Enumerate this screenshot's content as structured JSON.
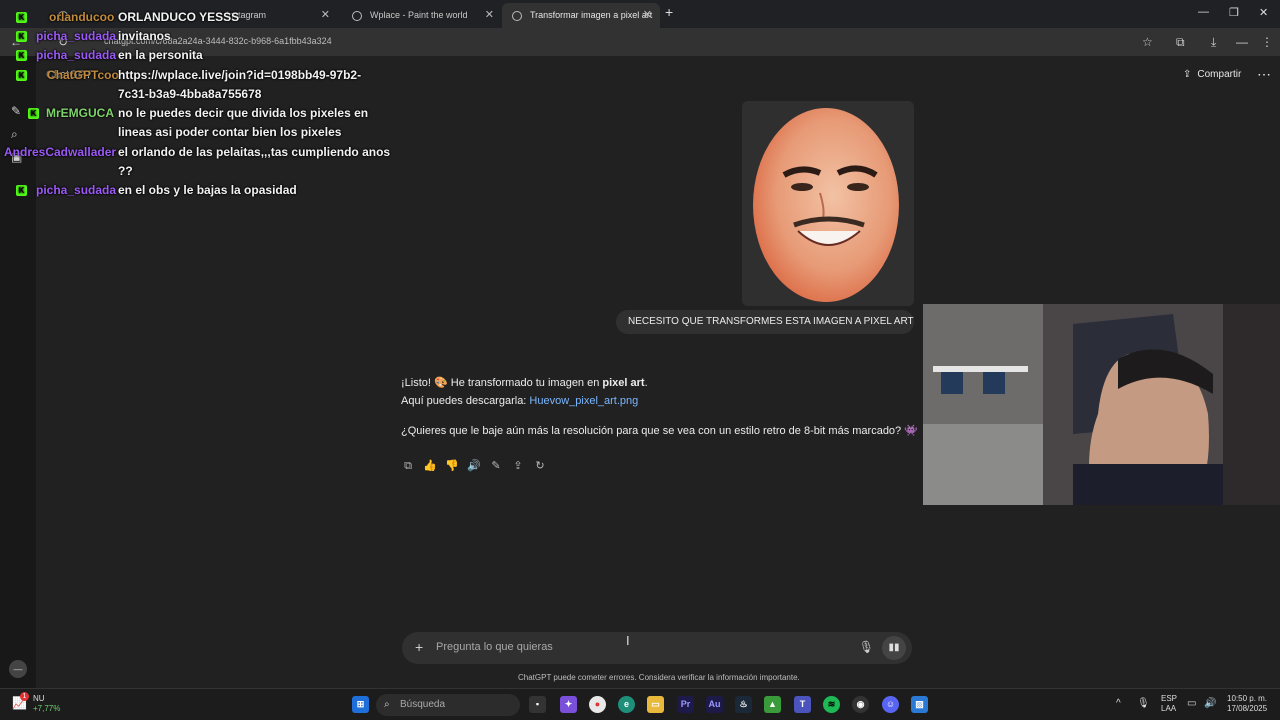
{
  "browser": {
    "tabs": [
      {
        "label": "Instagram",
        "active": false
      },
      {
        "label": "Wplace - Paint the world",
        "active": false
      },
      {
        "label": "Transformar imagen a pixel art",
        "active": true
      }
    ],
    "new_tab_label": "+",
    "url": "chatgpt.com/c/68a2a24a-3444-832c-b968-6a1fbb43a324",
    "window_controls": {
      "minimize": "—",
      "maximize": "❐",
      "close": "✕"
    }
  },
  "app": {
    "name_label": "ChatGPT",
    "share_label": "Compartir",
    "more_label": "⋯",
    "user_message": "NECESITO QUE TRANSFORMES ESTA IMAGEN A PIXEL ART",
    "reply": {
      "line1_pre": "¡Listo! 🎨 He transformado tu imagen en ",
      "line1_bold": "pixel art",
      "line1_post": ".",
      "line2_pre": "Aquí puedes descargarla: ",
      "line2_link": "Huevow_pixel_art.png",
      "line3": "¿Quieres que le baje aún más la resolución para que se vea con un estilo retro de 8-bit más marcado? 👾"
    },
    "actions": [
      {
        "icon": "copy-icon",
        "glyph": "⧉"
      },
      {
        "icon": "thumbs-up-icon",
        "glyph": "👍"
      },
      {
        "icon": "thumbs-down-icon",
        "glyph": "👎"
      },
      {
        "icon": "speaker-icon",
        "glyph": "🔊"
      },
      {
        "icon": "edit-icon",
        "glyph": "✎"
      },
      {
        "icon": "share-icon",
        "glyph": "⇪"
      },
      {
        "icon": "regenerate-icon",
        "glyph": "↻"
      }
    ],
    "input": {
      "placeholder": "Pregunta lo que quieras",
      "plus": "+",
      "mic": "🎙",
      "voice": "▮▮"
    },
    "disclaimer": "ChatGPT puede cometer errores. Considera verificar la información importante."
  },
  "overlay_chat": [
    {
      "user": "orlanducoo",
      "user_color": "#c08a3e",
      "message": "ORLANDUCO YESSS"
    },
    {
      "user": "picha_sudada",
      "user_color": "#9b59f5",
      "message": "invitanos"
    },
    {
      "user": "picha_sudada",
      "user_color": "#9b59f5",
      "message": "en la personita"
    },
    {
      "user": "ChatGPTcoo",
      "user_color": "#c08a3e",
      "message": "https://wplace.live/join?id=0198bb49-97b2-",
      "message2": "7c31-b3a9-4bba8a755678"
    },
    {
      "user": "MrEMGUCA",
      "user_color": "#7fd36b",
      "message": "no le puedes decir que divida los pixeles en",
      "message2": "lineas asi poder contar bien los pixeles"
    },
    {
      "user": "AndresCadwallader",
      "user_color": "#9b59f5",
      "message": "el orlando de las pelaitas,,,tas cumpliendo anos",
      "message2": "??"
    },
    {
      "user": "picha_sudada",
      "user_color": "#9b59f5",
      "message": "en el obs y le bajas la opasidad"
    }
  ],
  "taskbar": {
    "weather_line1": "NU",
    "weather_line2": "+7,77%",
    "weather_badge": "1",
    "search_label": "Búsqueda",
    "lang_line1": "ESP",
    "lang_line2": "LAA",
    "time": "10:50 p. m.",
    "date": "17/08/2025"
  }
}
